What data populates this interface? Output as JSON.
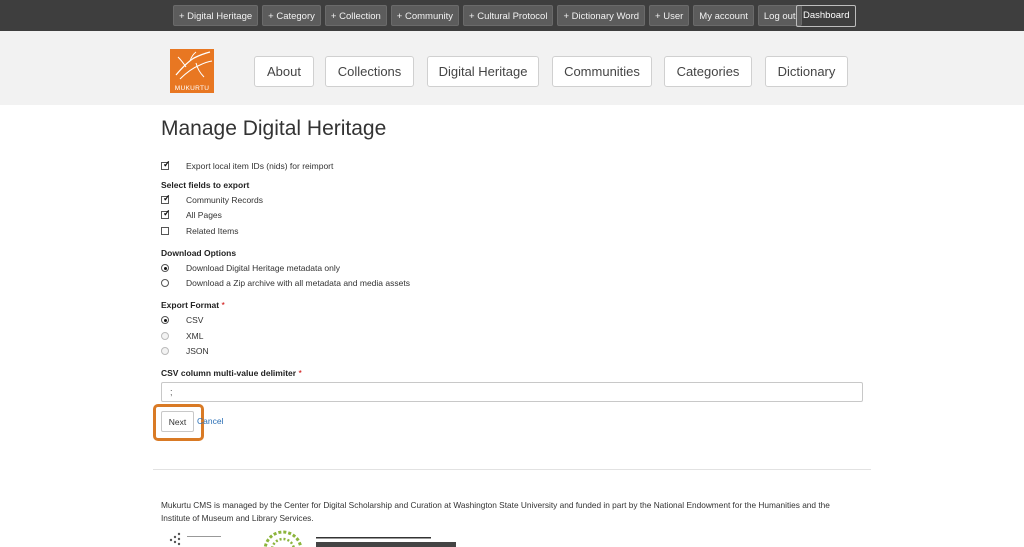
{
  "admin_bar": {
    "items": [
      "+ Digital Heritage",
      "+ Category",
      "+ Collection",
      "+ Community",
      "+ Cultural Protocol",
      "+ Dictionary Word",
      "+ User",
      "My account",
      "Log out"
    ],
    "dashboard": "Dashboard"
  },
  "header": {
    "logo_text": "MUKURTU",
    "nav": [
      "About",
      "Collections",
      "Digital Heritage",
      "Communities",
      "Categories",
      "Dictionary"
    ]
  },
  "main": {
    "title": "Manage Digital Heritage",
    "export_ids": {
      "label": "Export local item IDs (nids) for reimport",
      "checked": true
    },
    "fields_section": "Select fields to export",
    "fields": [
      {
        "label": "Community Records",
        "checked": true
      },
      {
        "label": "All Pages",
        "checked": true
      },
      {
        "label": "Related Items",
        "checked": false
      }
    ],
    "download_section": "Download Options",
    "download_options": [
      {
        "label": "Download Digital Heritage metadata only",
        "selected": true
      },
      {
        "label": "Download a Zip archive with all metadata and media assets",
        "selected": false
      }
    ],
    "format_section": "Export Format",
    "required_mark": "*",
    "formats": [
      {
        "label": "CSV",
        "selected": true
      },
      {
        "label": "XML",
        "selected": false
      },
      {
        "label": "JSON",
        "selected": false
      }
    ],
    "delimiter_label": "CSV column multi-value delimiter",
    "delimiter_value": ";",
    "next_label": "Next",
    "cancel_label": "Cancel"
  },
  "footer": {
    "text": "Mukurtu CMS is managed by the Center for Digital Scholarship and Curation at Washington State University and funded in part by the National Endowment for the Humanities and the Institute of Museum and Library Services."
  },
  "colors": {
    "accent": "#e87722",
    "admin_bar": "#3e3e3e",
    "link": "#2a6fb5"
  }
}
